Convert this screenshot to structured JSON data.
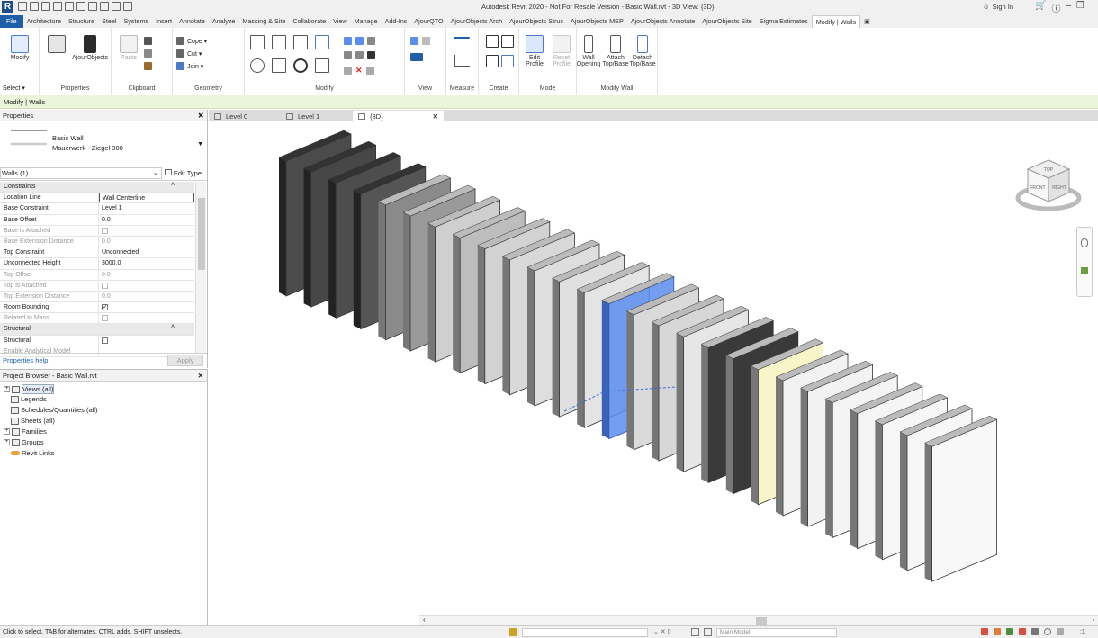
{
  "window": {
    "logo": "R",
    "title": "Autodesk Revit 2020 - Not For Resale Version - Basic Wall.rvt - 3D View: {3D}",
    "sign_in": "Sign In"
  },
  "ribbon_tabs": [
    "File",
    "Architecture",
    "Structure",
    "Steel",
    "Systems",
    "Insert",
    "Annotate",
    "Analyze",
    "Massing & Site",
    "Collaborate",
    "View",
    "Manage",
    "Add-Ins",
    "AjourQTO",
    "AjourObjects Arch",
    "AjourObjects Struc",
    "AjourObjects MEP",
    "AjourObjects Annotate",
    "AjourObjects Site",
    "Sigma Estimates",
    "Modify | Walls"
  ],
  "ribbon": {
    "modify_label": "Modify",
    "select_label": "Select ▾",
    "ajour_label": "AjourObjects",
    "properties_label": "Properties",
    "paste_label": "Paste",
    "cope_label": "Cope ▾",
    "cut_label": "Cut ▾",
    "join_label": "Join ▾",
    "groups": {
      "clipboard": "Clipboard",
      "geometry": "Geometry",
      "modify": "Modify",
      "view": "View",
      "measure": "Measure",
      "create": "Create",
      "mode": "Mode",
      "modify_wall": "Modify Wall"
    },
    "edit_profile": "Edit Profile",
    "reset_profile": "Reset Profile",
    "wall_opening": "Wall Opening",
    "attach": "Attach Top/Base",
    "detach": "Detach Top/Base"
  },
  "context_bar": "Modify | Walls",
  "properties": {
    "header": "Properties",
    "type_name": "Basic Wall",
    "type_sub": "Mauerwerk - Ziegel 300",
    "filter": "Walls (1)",
    "edit_type": "Edit Type",
    "rows": [
      {
        "k": "Constraints",
        "v": "",
        "sec": true
      },
      {
        "k": "Location Line",
        "v": "Wall Centerline"
      },
      {
        "k": "Base Constraint",
        "v": "Level 1"
      },
      {
        "k": "Base Offset",
        "v": "0.0"
      },
      {
        "k": "Base is Attached",
        "v": "",
        "dim": true,
        "chk": true
      },
      {
        "k": "Base Extension Distance",
        "v": "0.0",
        "dim": true
      },
      {
        "k": "Top Constraint",
        "v": "Unconnected"
      },
      {
        "k": "Unconnected Height",
        "v": "3000.0"
      },
      {
        "k": "Top Offset",
        "v": "0.0",
        "dim": true
      },
      {
        "k": "Top is Attached",
        "v": "",
        "dim": true,
        "chk": true
      },
      {
        "k": "Top Extension Distance",
        "v": "0.0",
        "dim": true
      },
      {
        "k": "Room Bounding",
        "v": "",
        "chk": true,
        "checked": true
      },
      {
        "k": "Related to Mass",
        "v": "",
        "dim": true,
        "chk": true
      },
      {
        "k": "Structural",
        "v": "",
        "sec": true
      },
      {
        "k": "Structural",
        "v": "",
        "chk": true
      },
      {
        "k": "Enable Analytical Model",
        "v": "",
        "dim": true
      }
    ],
    "help": "Properties help",
    "apply": "Apply"
  },
  "browser": {
    "header": "Project Browser - Basic Wall.rvt",
    "items": [
      "Views (all)",
      "Legends",
      "Schedules/Quantities (all)",
      "Sheets (all)",
      "Families",
      "Groups",
      "Revit Links"
    ]
  },
  "view_tabs": [
    "Level 0",
    "Level 1",
    "{3D}"
  ],
  "status": {
    "message": "Click to select, TAB for alternates, CTRL adds, SHIFT unselects.",
    "model": "Main Model",
    "filter_count": ":1"
  },
  "viewcube": {
    "top": "TOP",
    "front": "FRONT",
    "right": "RIGHT"
  },
  "colors": {
    "selected_wall": "#5b8def",
    "yellow_wall": "#f8f6c8",
    "dark_wall": "#3a3a3a"
  }
}
